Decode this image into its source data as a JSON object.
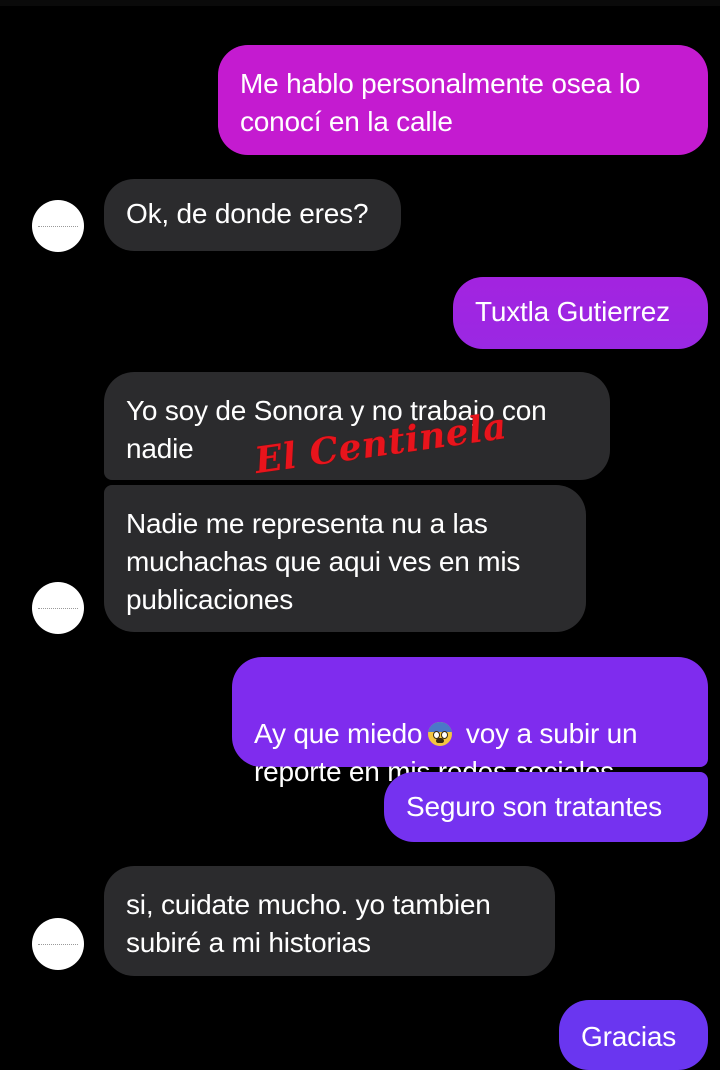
{
  "watermark": "El Centinela",
  "colors": {
    "background": "#000000",
    "incoming_bubble": "#2b2b2d",
    "outgoing_magenta": "#c41bd0",
    "outgoing_purple": "#7b2ff0",
    "watermark": "#e8141c"
  },
  "messages": [
    {
      "direction": "outgoing",
      "text": "Me hablo personalmente osea lo\nconocí en la calle"
    },
    {
      "direction": "incoming",
      "text": "Ok, de donde eres?"
    },
    {
      "direction": "outgoing",
      "text": "Tuxtla Gutierrez"
    },
    {
      "direction": "incoming",
      "text": "Yo soy de Sonora y no trabajo con\nnadie"
    },
    {
      "direction": "incoming",
      "text": "Nadie me representa nu a las\nmuchachas que aqui ves en mis\npublicaciones"
    },
    {
      "direction": "outgoing",
      "text_before_emoji": "Ay que miedo",
      "emoji": "anxious-face-with-sweat",
      "text_after_emoji": " voy a subir un",
      "text_line2": "reporte en mis redes sociales"
    },
    {
      "direction": "outgoing",
      "text": "Seguro son tratantes"
    },
    {
      "direction": "incoming",
      "text": "si, cuidate mucho. yo tambien\nsubiré a mi  historias"
    },
    {
      "direction": "outgoing",
      "text": "Gracias"
    }
  ]
}
